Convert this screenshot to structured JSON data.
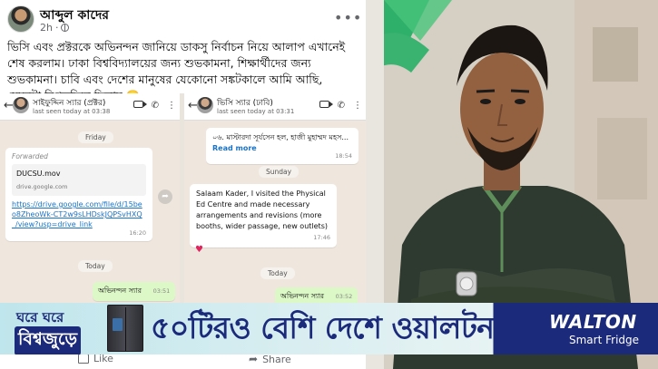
{
  "post": {
    "author": "আব্দুল কাদের",
    "time": "2h",
    "menu_icon": "•••",
    "text": "ভিসি এবং প্রক্টরকে অভিনন্দন জানিয়ে ডাকসু নির্বাচন নিয়ে আলাপ এখানেই শেষ করলাম। ঢাকা বিশ্ববিদ্যালয়ের জন্য শুভকামনা, শিক্ষার্থীদের জন্য শুভকামনা। চাবি এবং দেশের মানুষের যেকোনো সঙ্কটকালে আমি আছি, যেমনটা বিগতদিনে ছিলাম 🙂",
    "like_label": "Like",
    "share_label": "Share"
  },
  "chat_left": {
    "contact": "সাইফুদ্দিন স্যার (প্রক্টর)",
    "last_seen": "last seen today at 03:38",
    "day1": "Friday",
    "forwarded": "Forwarded",
    "file_name": "DUCSU.mov",
    "file_source": "drive.google.com",
    "link_text": "https://drive.google.com/file/d/15beo8ZheoWk-CT2w9sLHDskJQPSvHXQ_/view?usp=drive_link",
    "link_time": "16:20",
    "day2": "Today",
    "out_msg": "অভিনন্দন স্যার",
    "out_time": "03:51"
  },
  "chat_right": {
    "contact": "ভিসি স্যার (ঢাবি)",
    "last_seen": "last seen today at 03:31",
    "top_msg": "০৬. মাস্টারদা সূর্যসেন হল, হাজী মুহাম্মদ মহস...",
    "read_more": "Read more",
    "top_time": "18:54",
    "day1": "Sunday",
    "in_msg": "Salaam Kader, I visited the Physical Ed Centre and made necessary arrangements and revisions (more booths, wider passage, new outlets)",
    "in_time": "17:46",
    "day2": "Today",
    "out_msg": "অভিনন্দন স্যার",
    "out_time": "03:52"
  },
  "ad": {
    "slogan_line1": "ঘরে ঘরে",
    "slogan_line2": "বিশ্বজুড়ে",
    "headline": "৫০টিরও বেশি দেশে ওয়ালটন",
    "brand": "WALTON",
    "product": "Smart Fridge"
  }
}
